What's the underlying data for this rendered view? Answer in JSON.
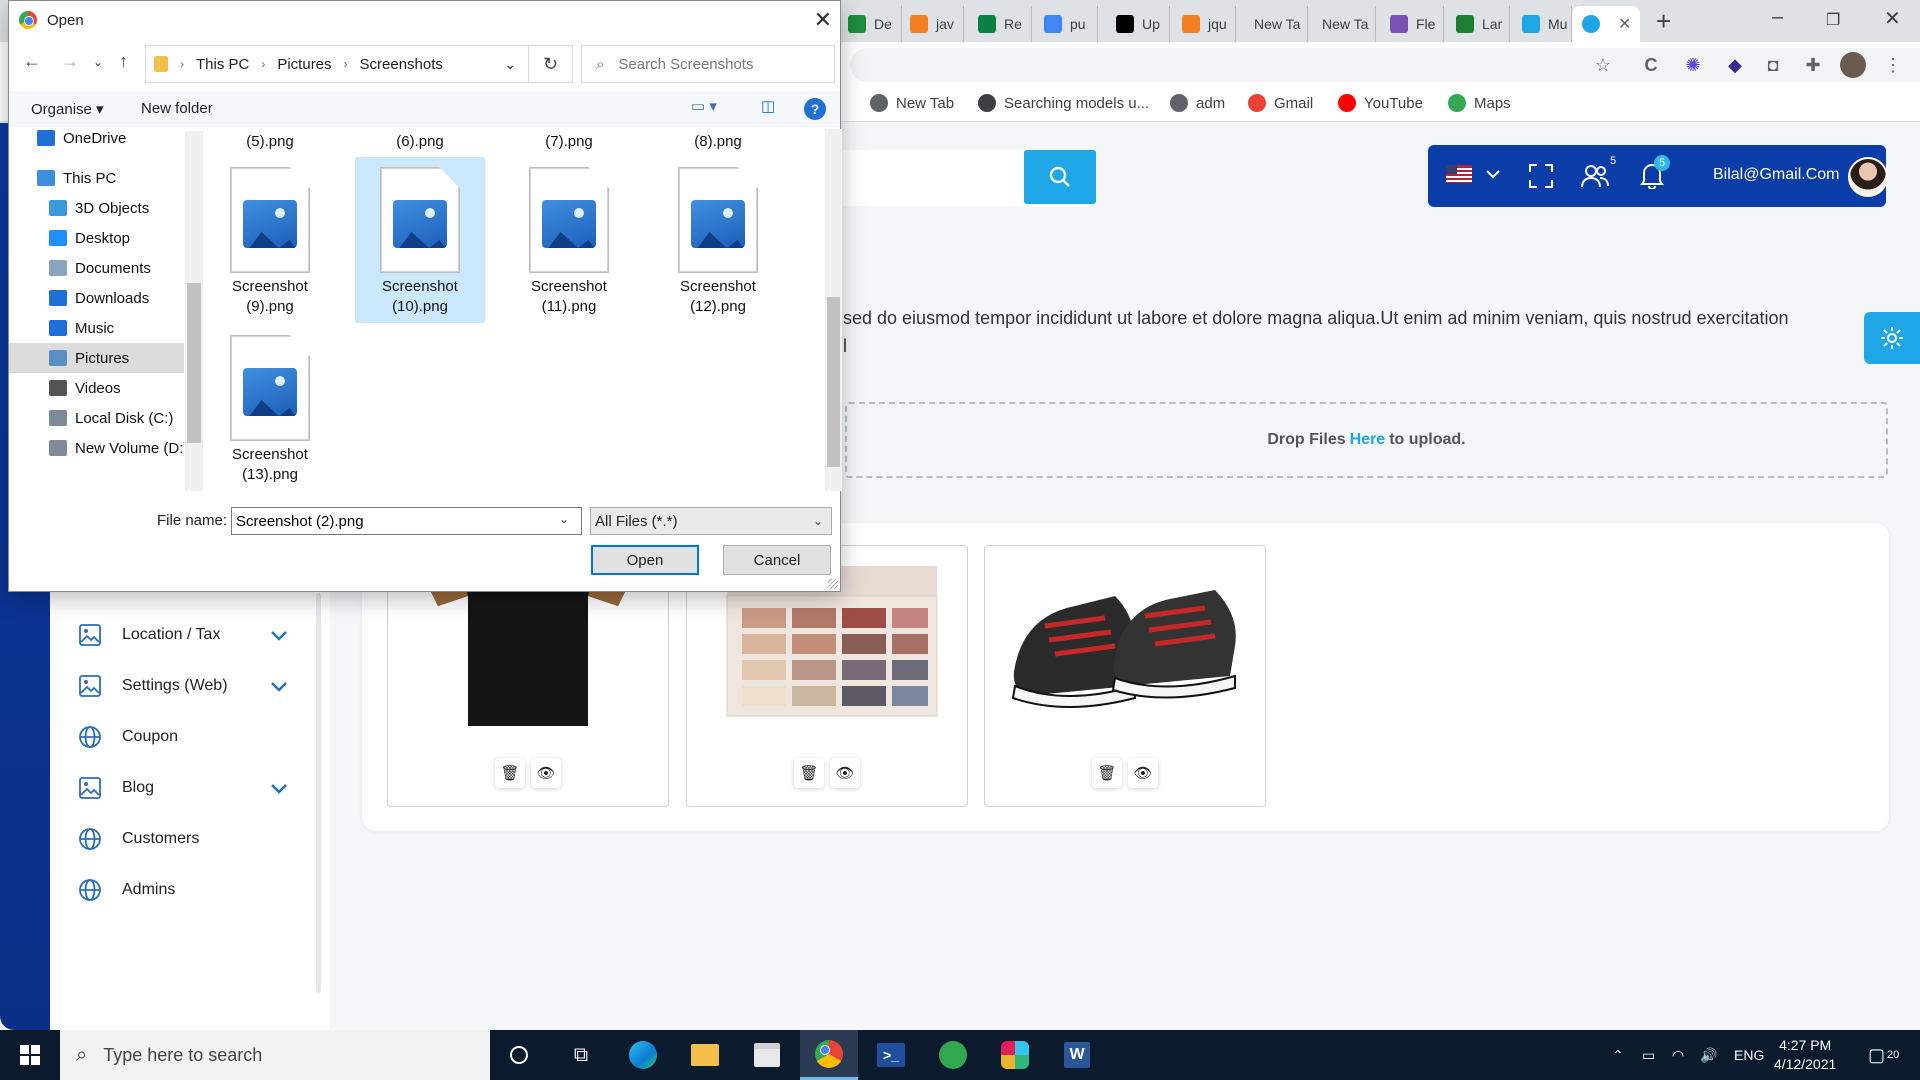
{
  "browser": {
    "tabs": [
      {
        "label": "De",
        "color": "#1e8e3e",
        "icon": "ext-icon"
      },
      {
        "label": "jav",
        "color": "#f48024",
        "icon": "stackoverflow-icon"
      },
      {
        "label": "Re",
        "color": "#0b8043",
        "icon": "vue-icon"
      },
      {
        "label": "pu",
        "color": "#4285f4",
        "icon": "google-icon"
      },
      {
        "label": "Up",
        "color": "#000000",
        "icon": "medium-icon"
      },
      {
        "label": "jqu",
        "color": "#f48024",
        "icon": "stackoverflow-icon"
      },
      {
        "label": "New Ta",
        "color": "",
        "icon": ""
      },
      {
        "label": "New Ta",
        "color": "",
        "icon": ""
      },
      {
        "label": "Fle",
        "color": "#7952b3",
        "icon": "bootstrap-icon"
      },
      {
        "label": "Lar",
        "color": "#1e7e34",
        "icon": "mountain-icon"
      },
      {
        "label": "Mu",
        "color": "#1ea6e6",
        "icon": "app-icon"
      }
    ],
    "bookmarks": [
      {
        "label": "New Tab",
        "color": "#5f6368"
      },
      {
        "label": "Searching models u...",
        "color": "#3c4043"
      },
      {
        "label": "adm",
        "color": "#5f6368"
      },
      {
        "label": "Gmail",
        "color": "#ea4335"
      },
      {
        "label": "YouTube",
        "color": "#ff0000"
      },
      {
        "label": "Maps",
        "color": "#34a853"
      }
    ]
  },
  "page": {
    "user_email": "Bilal@Gmail.Com",
    "friends_badge": "5",
    "notif_badge": "5",
    "description": "sed do eiusmod tempor incididunt ut labore et dolore magna aliqua.Ut enim ad minim veniam, quis nostrud exercitation",
    "description_cont": "l",
    "dropzone": {
      "prefix": "Drop Files",
      "link": "Here",
      "suffix": "to upload."
    },
    "sidebar": [
      {
        "label": "Location / Tax",
        "icon": "image-icon",
        "expandable": true
      },
      {
        "label": "Settings (Web)",
        "icon": "image-icon",
        "expandable": true
      },
      {
        "label": "Coupon",
        "icon": "globe-icon",
        "expandable": false
      },
      {
        "label": "Blog",
        "icon": "image-icon",
        "expandable": true
      },
      {
        "label": "Customers",
        "icon": "globe-icon",
        "expandable": false
      },
      {
        "label": "Admins",
        "icon": "globe-icon",
        "expandable": false
      }
    ],
    "products": [
      {
        "name": "t-shirt",
        "icon": "tshirt-image"
      },
      {
        "name": "palette",
        "icon": "eyeshadow-palette-image"
      },
      {
        "name": "shoes",
        "icon": "sneakers-image"
      }
    ]
  },
  "dialog": {
    "title": "Open",
    "breadcrumb": [
      "This PC",
      "Pictures",
      "Screenshots"
    ],
    "search_placeholder": "Search Screenshots",
    "organise": "Organise",
    "new_folder": "New folder",
    "tree": [
      {
        "label": "OneDrive",
        "color": "#1e6fd6",
        "indent": 0
      },
      {
        "label": "This PC",
        "color": "#3b8edb",
        "indent": 0
      },
      {
        "label": "3D Objects",
        "color": "#3a9ad9",
        "indent": 1
      },
      {
        "label": "Desktop",
        "color": "#1e90ff",
        "indent": 1
      },
      {
        "label": "Documents",
        "color": "#8aa4c0",
        "indent": 1
      },
      {
        "label": "Downloads",
        "color": "#1e6fd6",
        "indent": 1
      },
      {
        "label": "Music",
        "color": "#1e6fd6",
        "indent": 1
      },
      {
        "label": "Pictures",
        "color": "#5a8fc2",
        "indent": 1,
        "selected": true
      },
      {
        "label": "Videos",
        "color": "#555",
        "indent": 1
      },
      {
        "label": "Local Disk (C:)",
        "color": "#7c8a99",
        "indent": 1
      },
      {
        "label": "New Volume (D:)",
        "color": "#7c8a99",
        "indent": 1
      }
    ],
    "top_labels": [
      "(5).png",
      "(6).png",
      "(7).png",
      "(8).png"
    ],
    "files": [
      {
        "line1": "Screenshot",
        "line2": "(9).png",
        "selected": false
      },
      {
        "line1": "Screenshot",
        "line2": "(10).png",
        "selected": true
      },
      {
        "line1": "Screenshot",
        "line2": "(11).png",
        "selected": false
      },
      {
        "line1": "Screenshot",
        "line2": "(12).png",
        "selected": false
      },
      {
        "line1": "Screenshot",
        "line2": "(13).png",
        "selected": false
      }
    ],
    "file_name_label": "File name:",
    "file_name_value": "Screenshot (2).png",
    "file_type": "All Files (*.*)",
    "open_label": "Open",
    "cancel_label": "Cancel"
  },
  "taskbar": {
    "search_placeholder": "Type here to search",
    "language": "ENG",
    "time": "4:27 PM",
    "date": "4/12/2021",
    "notification_count": "20"
  }
}
